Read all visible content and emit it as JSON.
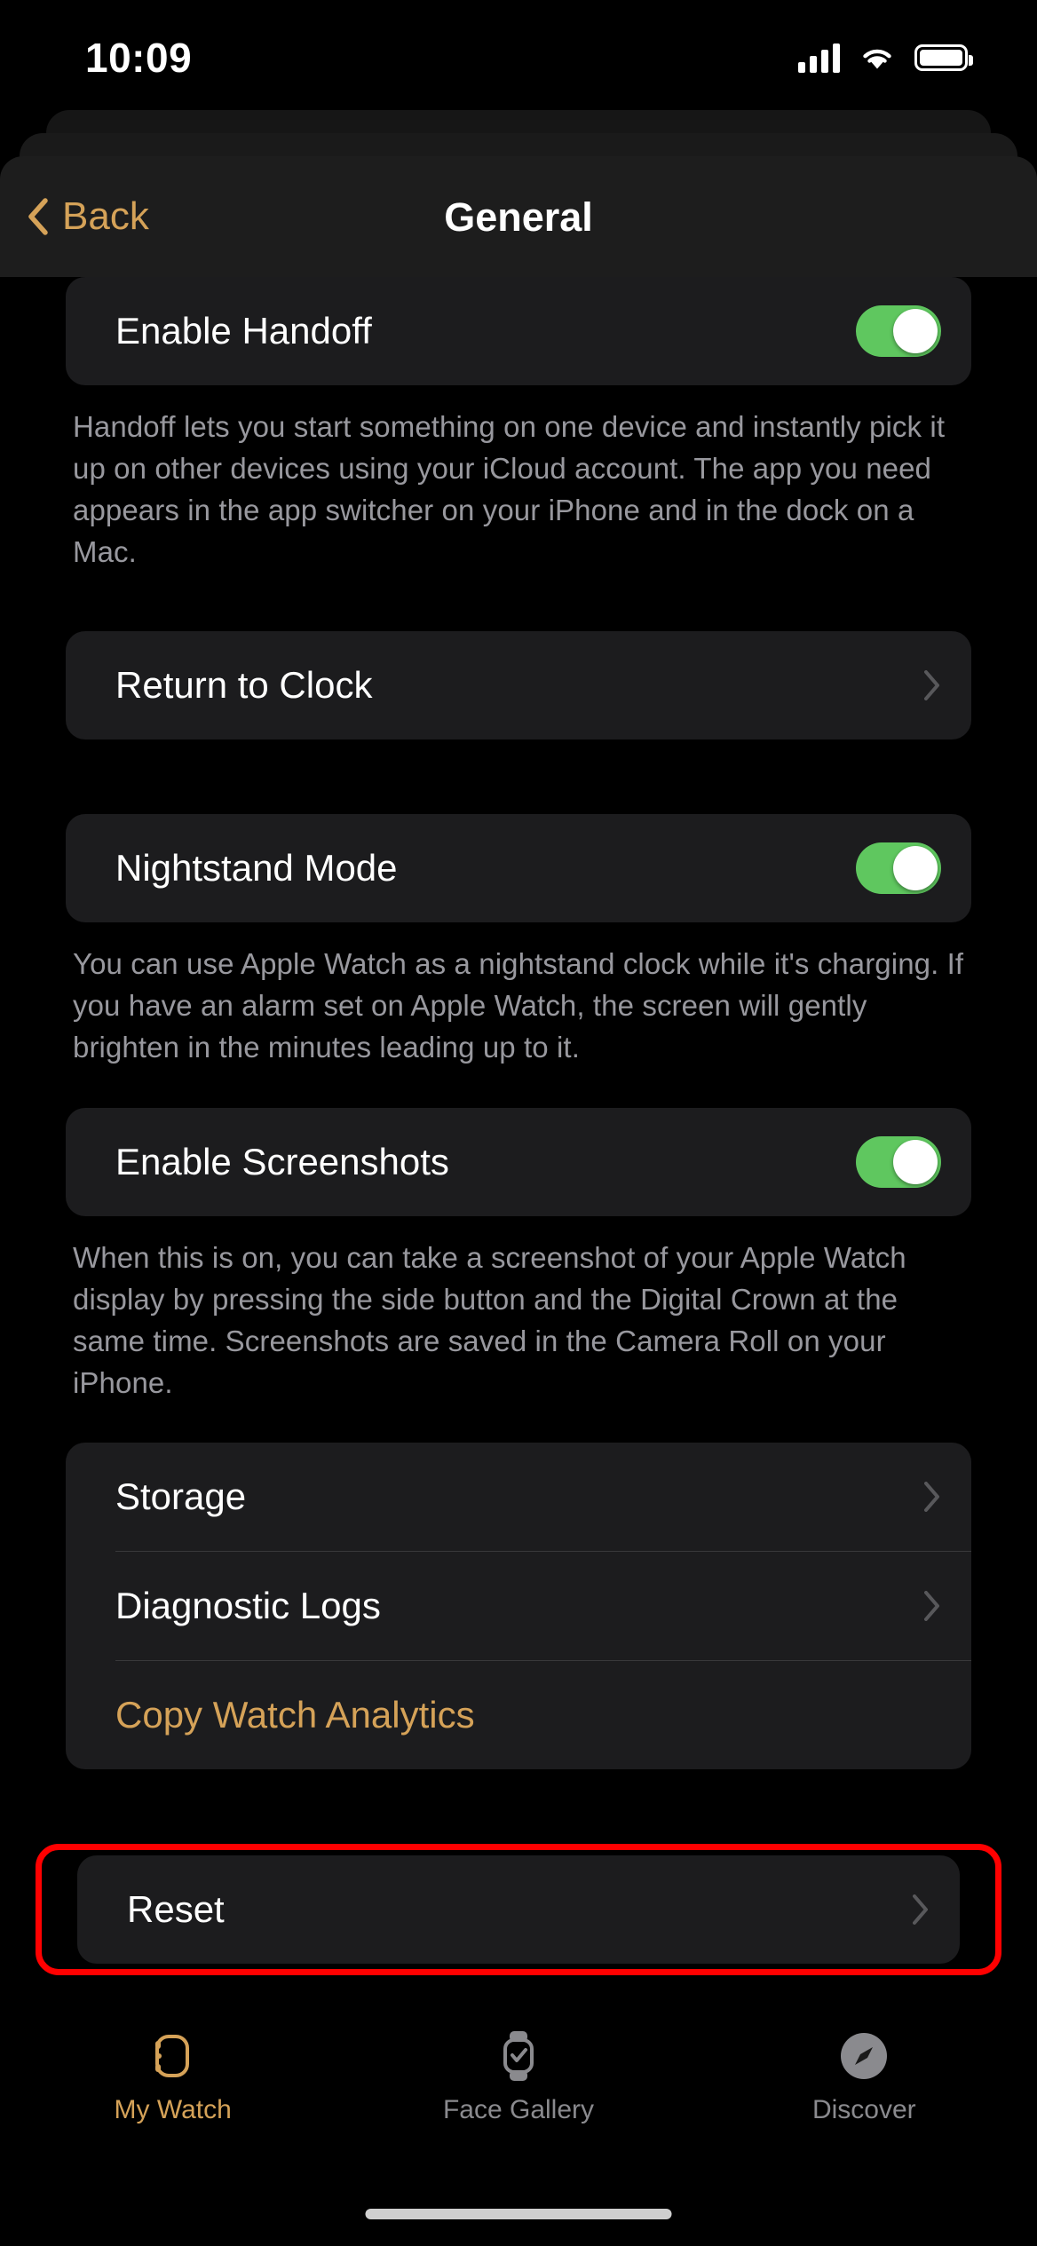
{
  "status_bar": {
    "time": "10:09",
    "signal_icon": "cellular-signal-icon",
    "wifi_icon": "wifi-icon",
    "battery_icon": "battery-full-icon"
  },
  "nav": {
    "back_label": "Back",
    "back_icon": "chevron-left-icon",
    "title": "General"
  },
  "colors": {
    "accent": "#D5A258",
    "toggle_on": "#5FC75F",
    "card_bg": "#1C1C1E",
    "footnote": "#98989E",
    "highlight": "#FF0000"
  },
  "sections": {
    "handoff": {
      "label": "Enable Handoff",
      "toggle_state": "on",
      "footnote": "Handoff lets you start something on one device and instantly pick it up on other devices using your iCloud account. The app you need appears in the app switcher on your iPhone and in the dock on a Mac."
    },
    "return_to_clock": {
      "label": "Return to Clock",
      "chevron_icon": "chevron-right-icon"
    },
    "nightstand": {
      "label": "Nightstand Mode",
      "toggle_state": "on",
      "footnote": "You can use Apple Watch as a nightstand clock while it's charging. If you have an alarm set on Apple Watch, the screen will gently brighten in the minutes leading up to it."
    },
    "screenshots": {
      "label": "Enable Screenshots",
      "toggle_state": "on",
      "footnote": "When this is on, you can take a screenshot of your Apple Watch display by pressing the side button and the Digital Crown at the same time. Screenshots are saved in the Camera Roll on your iPhone."
    },
    "diagnostics_group": [
      {
        "label": "Storage",
        "chevron_icon": "chevron-right-icon"
      },
      {
        "label": "Diagnostic Logs",
        "chevron_icon": "chevron-right-icon"
      },
      {
        "label": "Copy Watch Analytics",
        "accent": true
      }
    ],
    "reset": {
      "label": "Reset",
      "chevron_icon": "chevron-right-icon",
      "highlighted": true
    }
  },
  "tab_bar": {
    "tabs": [
      {
        "label": "My Watch",
        "icon": "apple-watch-icon",
        "active": true
      },
      {
        "label": "Face Gallery",
        "icon": "watch-face-icon",
        "active": false
      },
      {
        "label": "Discover",
        "icon": "compass-icon",
        "active": false
      }
    ]
  }
}
